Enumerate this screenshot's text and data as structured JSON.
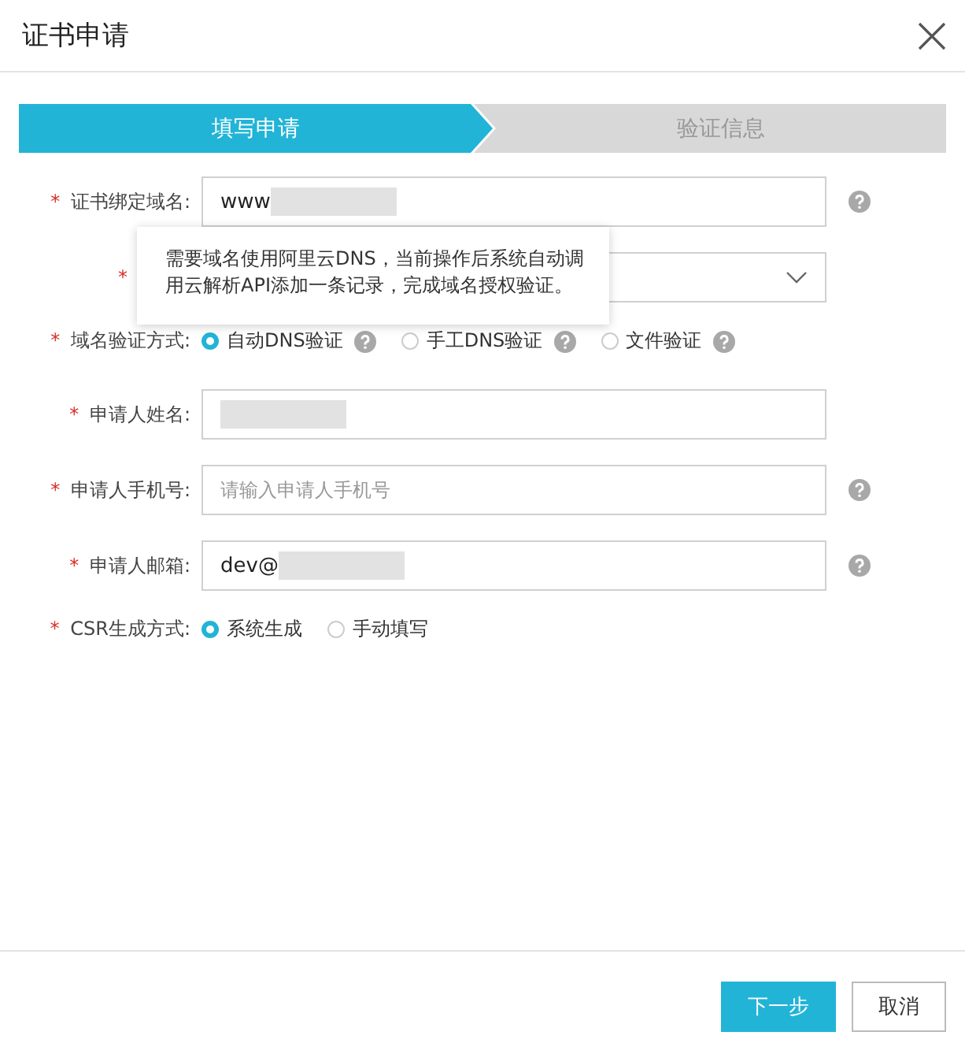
{
  "dialog": {
    "title": "证书申请"
  },
  "steps": [
    {
      "label": "填写申请",
      "selected": true
    },
    {
      "label": "验证信息",
      "selected": false
    }
  ],
  "fields": [
    {
      "kind": "input",
      "label": "证书绑定域名:",
      "required": "*",
      "value": "www",
      "redacted": true,
      "help": true
    },
    {
      "kind": "select",
      "required": "*"
    },
    {
      "kind": "radio",
      "label": "域名验证方式:",
      "required": "*",
      "options": [
        {
          "label": "自动DNS验证",
          "selected": true,
          "help": true
        },
        {
          "label": "手工DNS验证",
          "selected": false,
          "help": true
        },
        {
          "label": "文件验证",
          "selected": false,
          "help": true
        }
      ]
    },
    {
      "kind": "input",
      "label": "申请人姓名:",
      "required": "*",
      "redacted": true,
      "help": false
    },
    {
      "kind": "input",
      "label": "申请人手机号:",
      "required": "*",
      "placeholder": "请输入申请人手机号",
      "help": true
    },
    {
      "kind": "input",
      "label": "申请人邮箱:",
      "required": "*",
      "value": "dev@",
      "redacted": true,
      "help": true
    },
    {
      "kind": "radio",
      "label": "CSR生成方式:",
      "required": "*",
      "options": [
        {
          "label": "系统生成",
          "selected": true,
          "help": false
        },
        {
          "label": "手动填写",
          "selected": false,
          "help": false
        }
      ]
    }
  ],
  "tooltip": "需要域名使用阿里云DNS，当前操作后系统自动调用云解析API添加一条记录，完成域名授权验证。",
  "buttons": [
    {
      "label": "下一步",
      "kind": "primary"
    },
    {
      "label": "取消",
      "kind": "default"
    }
  ]
}
